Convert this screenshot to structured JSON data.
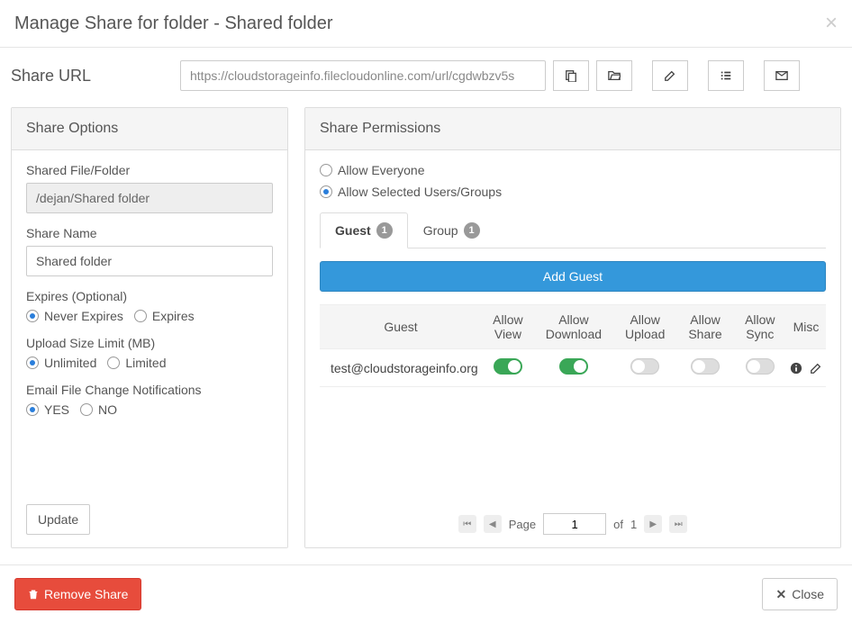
{
  "header": {
    "title": "Manage Share for folder - Shared folder"
  },
  "shareUrl": {
    "label": "Share URL",
    "value": "https://cloudstorageinfo.filecloudonline.com/url/cgdwbzv5s"
  },
  "shareOptions": {
    "heading": "Share Options",
    "sharedFileLabel": "Shared File/Folder",
    "sharedFileValue": "/dejan/Shared folder",
    "shareNameLabel": "Share Name",
    "shareNameValue": "Shared folder",
    "expiresLabel": "Expires (Optional)",
    "expires": {
      "neverLabel": "Never Expires",
      "expiresLabel": "Expires"
    },
    "uploadLimitLabel": "Upload Size Limit (MB)",
    "uploadLimit": {
      "unlimitedLabel": "Unlimited",
      "limitedLabel": "Limited"
    },
    "emailNotifLabel": "Email File Change Notifications",
    "emailNotif": {
      "yesLabel": "YES",
      "noLabel": "NO"
    },
    "updateBtn": "Update"
  },
  "sharePermissions": {
    "heading": "Share Permissions",
    "allowEveryoneLabel": "Allow Everyone",
    "allowSelectedLabel": "Allow Selected Users/Groups",
    "tabs": {
      "guest": {
        "label": "Guest",
        "count": "1"
      },
      "group": {
        "label": "Group",
        "count": "1"
      }
    },
    "addGuestBtn": "Add Guest",
    "columns": {
      "guest": "Guest",
      "view": "Allow View",
      "download": "Allow Download",
      "upload": "Allow Upload",
      "share": "Allow Share",
      "sync": "Allow Sync",
      "misc": "Misc"
    },
    "rows": [
      {
        "email": "test@cloudstorageinfo.org"
      }
    ],
    "pager": {
      "pageLabel": "Page",
      "current": "1",
      "ofLabel": "of",
      "total": "1"
    }
  },
  "footer": {
    "removeBtn": "Remove Share",
    "closeBtn": "Close"
  }
}
